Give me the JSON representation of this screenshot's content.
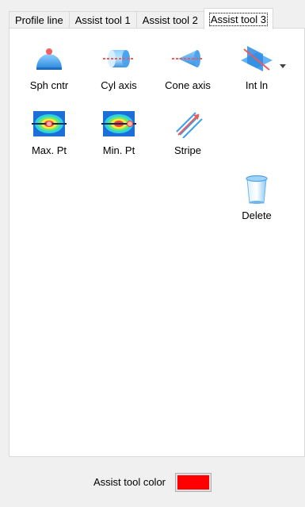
{
  "tabs": [
    {
      "label": "Profile line",
      "active": false
    },
    {
      "label": "Assist tool 1",
      "active": false
    },
    {
      "label": "Assist tool 2",
      "active": false
    },
    {
      "label": "Assist tool 3",
      "active": true
    }
  ],
  "tools": {
    "sph_cntr": {
      "label": "Sph cntr",
      "icon": "sphere-center-icon"
    },
    "cyl_axis": {
      "label": "Cyl axis",
      "icon": "cylinder-axis-icon"
    },
    "cone_axis": {
      "label": "Cone axis",
      "icon": "cone-axis-icon"
    },
    "int_ln": {
      "label": "Int ln",
      "icon": "intersection-line-icon",
      "has_dropdown": true
    },
    "max_pt": {
      "label": "Max. Pt",
      "icon": "max-point-icon"
    },
    "min_pt": {
      "label": "Min. Pt",
      "icon": "min-point-icon"
    },
    "stripe": {
      "label": "Stripe",
      "icon": "stripe-icon"
    },
    "delete": {
      "label": "Delete",
      "icon": "trash-icon"
    }
  },
  "footer": {
    "label": "Assist tool color",
    "color": "#ff0000"
  }
}
